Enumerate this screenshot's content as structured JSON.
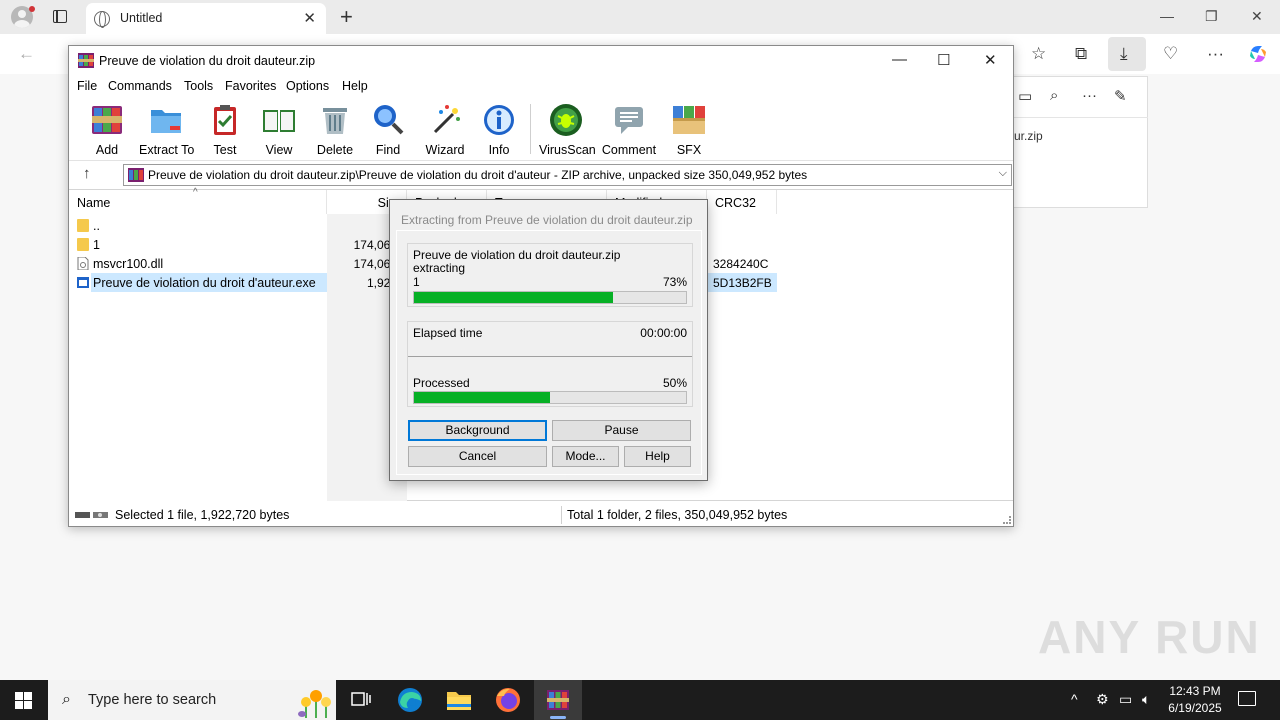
{
  "browser": {
    "tab_title": "Untitled",
    "download_item": "ur.zip",
    "watermark": "ANY RUN"
  },
  "winrar": {
    "window_title": "Preuve de violation du droit dauteur.zip",
    "menu": [
      "File",
      "Commands",
      "Tools",
      "Favorites",
      "Options",
      "Help"
    ],
    "toolbar": [
      "Add",
      "Extract To",
      "Test",
      "View",
      "Delete",
      "Find",
      "Wizard",
      "Info",
      "VirusScan",
      "Comment",
      "SFX"
    ],
    "address": "Preuve de violation du droit dauteur.zip\\Preuve de violation du droit d'auteur - ZIP archive, unpacked size 350,049,952 bytes",
    "columns": [
      "Name",
      "Size",
      "Packed",
      "Type",
      "Modified",
      "CRC32"
    ],
    "files": [
      {
        "name": "..",
        "size": "",
        "crc": ""
      },
      {
        "name": "1",
        "size": "174,063,6",
        "crc": ""
      },
      {
        "name": "msvcr100.dll",
        "size": "174,063,6",
        "crc": "3284240C"
      },
      {
        "name": "Preuve de violation du droit d'auteur.exe",
        "size": "1,922,7",
        "crc": "5D13B2FB"
      }
    ],
    "status_left": "Selected 1 file, 1,922,720 bytes",
    "status_right": "Total 1 folder, 2 files, 350,049,952 bytes"
  },
  "dialog": {
    "title": "Extracting from Preuve de violation du droit dauteur.zip",
    "archive": "Preuve de violation du droit dauteur.zip",
    "action": "extracting",
    "current_item": "1",
    "current_percent": "73%",
    "current_progress": 0.73,
    "elapsed_label": "Elapsed time",
    "elapsed_value": "00:00:00",
    "processed_label": "Processed",
    "processed_percent": "50%",
    "processed_progress": 0.5,
    "buttons": {
      "background": "Background",
      "pause": "Pause",
      "cancel": "Cancel",
      "mode": "Mode...",
      "help": "Help"
    }
  },
  "taskbar": {
    "search_placeholder": "Type here to search",
    "time": "12:43 PM",
    "date": "6/19/2025"
  },
  "colors": {
    "progress_fill": "#06b025",
    "selection": "#cce8ff",
    "taskbar": "#1c1c1c"
  }
}
